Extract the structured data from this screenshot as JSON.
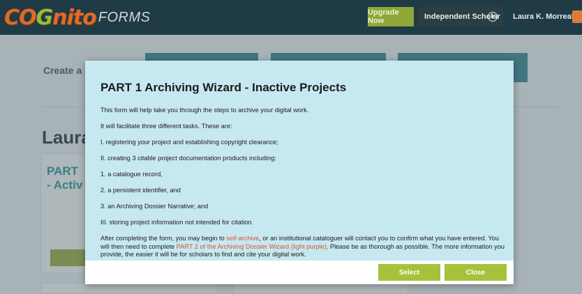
{
  "header": {
    "logo_main": "COGNITO",
    "logo_sub": "FORMS",
    "upgrade_label": "Upgrade Now",
    "account_label": "Independent Scholar",
    "user_name": "Laura K. Morreale"
  },
  "background": {
    "create_label": "Create a N",
    "name_heading": "Laura",
    "card_title": "PART\n- Activ",
    "card_button": "Selec"
  },
  "modal": {
    "title": "PART 1 Archiving Wizard - Inactive Projects",
    "lines": [
      "This form will help take you through the steps to archive your digital work.",
      "It will facilitate three different tasks. These are:",
      "I. registering your project and establishing copyright clearance;",
      "II. creating 3 citable project documentation products including:",
      "1. a catalogue record,",
      "2. a persistent identifier, and",
      "3. an Archiving Dossier Narrative; and",
      "III. storing project information not intended for citation."
    ],
    "final_paragraph": {
      "text_1": "After completing the form, you may begin to ",
      "link_1": "self-archive",
      "text_2": ", or an institutional cataloguer will contact you to confirm what you have entered. You will then need to complete ",
      "link_2": "PART 2 of the Archiving Dossier Wizard (light purple)",
      "text_3": ". Please be as thorough as possible. The more information you provide, the easier it will be for scholars to find and cite your digital work."
    },
    "select_label": "Select",
    "close_label": "Close"
  }
}
